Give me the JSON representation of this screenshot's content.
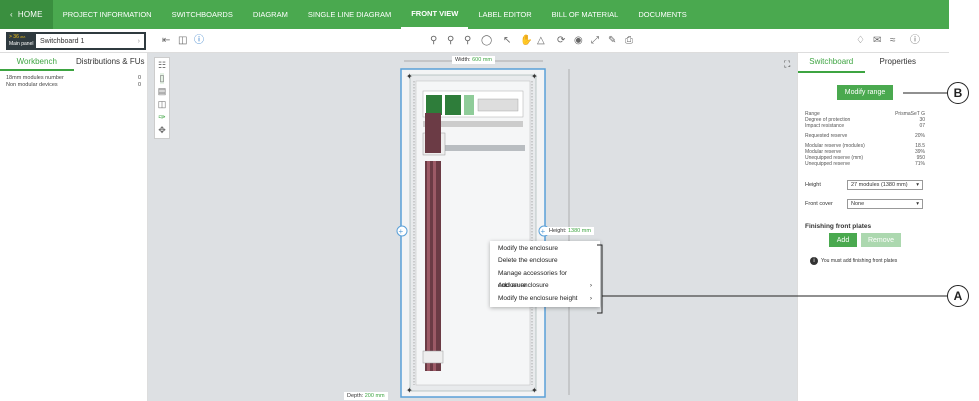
{
  "nav": {
    "home": "HOME",
    "items": [
      "PROJECT INFORMATION",
      "SWITCHBOARDS",
      "DIAGRAM",
      "SINGLE LINE DIAGRAM",
      "FRONT VIEW",
      "LABEL EDITOR",
      "BILL OF MATERIAL",
      "DOCUMENTS"
    ],
    "active": "FRONT VIEW"
  },
  "panel_selector": {
    "label_top": "> 36 ₘₙ",
    "label_bottom": "Main panel",
    "name": "Switchboard 1"
  },
  "left_panel": {
    "tabs": [
      "Workbench",
      "Distributions & FUs"
    ],
    "rows": [
      {
        "label": "18mm modules number",
        "value": "0"
      },
      {
        "label": "Non modular devices",
        "value": "0"
      }
    ]
  },
  "canvas": {
    "width_tag_label": "Width:",
    "width_tag_value": "600 mm",
    "height_tag_label": "Height:",
    "height_tag_value": "1380 mm",
    "depth_tag_label": "Depth:",
    "depth_tag_value": "200 mm"
  },
  "context_menu": {
    "items": [
      {
        "label": "Modify the enclosure",
        "arrow": ""
      },
      {
        "label": "Delete the enclosure",
        "arrow": ""
      },
      {
        "label": "Manage accessories for enclosure",
        "arrow": ""
      },
      {
        "label": "Add an enclosure",
        "arrow": "›"
      },
      {
        "label": "Modify the enclosure height",
        "arrow": "›"
      }
    ]
  },
  "right_panel": {
    "tabs": [
      "Switchboard",
      "Properties"
    ],
    "modify_range": "Modify range",
    "props1": [
      {
        "label": "Range",
        "value": "PrismaSeT G"
      },
      {
        "label": "Degree of protection",
        "value": "30"
      },
      {
        "label": "Impact resistance",
        "value": "07"
      }
    ],
    "requested_reserve": {
      "label": "Requested reserve",
      "value": "20%"
    },
    "props2": [
      {
        "label": "Modular reserve (modules)",
        "value": "18.5"
      },
      {
        "label": "Modular reserve",
        "value": "39%"
      },
      {
        "label": "Unequipped reserve (mm)",
        "value": "950"
      },
      {
        "label": "Unequipped reserve",
        "value": "71%"
      }
    ],
    "height_label": "Height",
    "height_value": "27 modules (1380 mm)",
    "front_cover_label": "Front cover",
    "front_cover_value": "None",
    "finishing_title": "Finishing front plates",
    "add": "Add",
    "remove": "Remove",
    "info": "You must add finishing front plates"
  },
  "callouts": {
    "a": "A",
    "b": "B"
  }
}
